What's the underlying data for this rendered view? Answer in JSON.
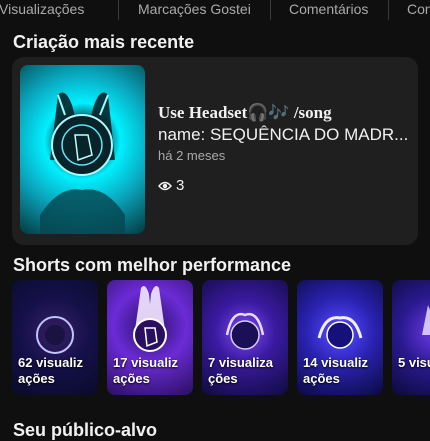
{
  "tabs": [
    "Visualizações",
    "Marcações Gostei",
    "Comentários",
    "Con"
  ],
  "latest": {
    "heading": "Criação mais recente",
    "title_line1": "Use Headset🎧🎶 /song",
    "title_line2": "name: SEQUÊNCIA DO MADR...",
    "date": "há 2 meses",
    "views": "3"
  },
  "shorts": {
    "heading": "Shorts com melhor performance",
    "items": [
      {
        "label": "62 visualiz ações"
      },
      {
        "label": "17 visualiz ações"
      },
      {
        "label": "7 visualiza ções"
      },
      {
        "label": "14 visualiz ações"
      },
      {
        "label": "5 visu ções"
      }
    ]
  },
  "audience": {
    "heading": "Seu público-alvo"
  }
}
